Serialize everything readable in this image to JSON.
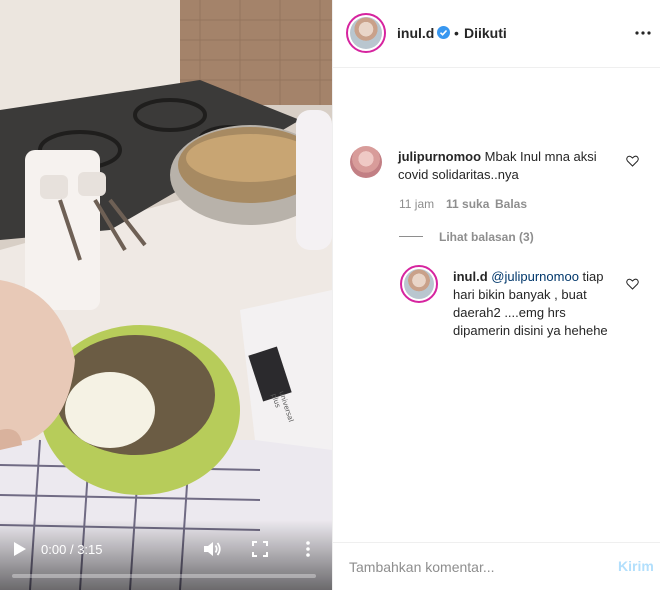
{
  "video": {
    "time_current": "0:00",
    "time_separator": "/",
    "time_total": "3:15",
    "progress": 0,
    "icons": [
      "play-icon",
      "volume-icon",
      "fullscreen-icon",
      "more-vertical-icon"
    ],
    "scale_brand_text": "universal plus"
  },
  "header": {
    "username": "inul.d",
    "separator": "•",
    "follow_label": "Diikuti",
    "icons": [
      "verified-badge-icon",
      "more-horizontal-icon"
    ]
  },
  "comment": {
    "username": "julipurnomoo",
    "text": " Mbak Inul mna aksi covid solidaritas..nya",
    "time": "11 jam",
    "likes": "11 suka",
    "reply_label": "Balas",
    "view_replies": "Lihat balasan (3)"
  },
  "reply": {
    "username": "inul.d",
    "mention": "@julipurnomoo",
    "text": " tiap hari bikin banyak , buat daerah2 ....emg hrs dipamerin disini ya hehehe"
  },
  "footer": {
    "placeholder": "Tambahkan komentar...",
    "post_label": "Kirim"
  },
  "colors": {
    "verified": "#3897f0",
    "link": "#00376b",
    "muted": "#8e8e8e",
    "post_disabled": "#b2dffc",
    "story_ring": "#d6249f"
  }
}
